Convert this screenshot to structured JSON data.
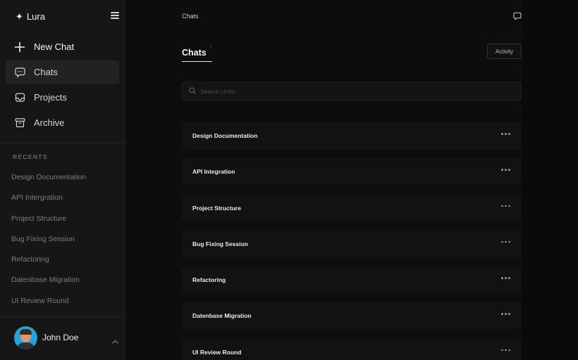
{
  "brand": {
    "mark": "✦",
    "name": "Lura"
  },
  "nav": [
    {
      "label": "New Chat",
      "icon": "plus-icon"
    },
    {
      "label": "Chats",
      "icon": "chat-bubble-icon",
      "active": true
    },
    {
      "label": "Projects",
      "icon": "inbox-icon"
    },
    {
      "label": "Archive",
      "icon": "archive-icon"
    }
  ],
  "recents": {
    "title": "RECENTS",
    "items": [
      "Design Documentation",
      "API Intergration",
      "Project Structure",
      "Bug Fixing Session",
      "Refactoring",
      "Datenbase Migration",
      "UI Review Round"
    ]
  },
  "user": {
    "name": "John Doe"
  },
  "header": {
    "title": "Chats"
  },
  "tabs": {
    "chats_label": "Chats",
    "chats_count": "7",
    "activity_label": "Activity"
  },
  "search": {
    "placeholder": "Search chats",
    "value": ""
  },
  "chats": [
    "Design Documentation",
    "API Integration",
    "Project Structure",
    "Bug Fixing Session",
    "Refactoring",
    "Datenbase Migration",
    "UI Review Round"
  ],
  "colors": {
    "sidebar_bg": "#161616",
    "main_bg": "#0d0d0d",
    "active_item": "#222222",
    "avatar_bg": "#27a3d8"
  }
}
